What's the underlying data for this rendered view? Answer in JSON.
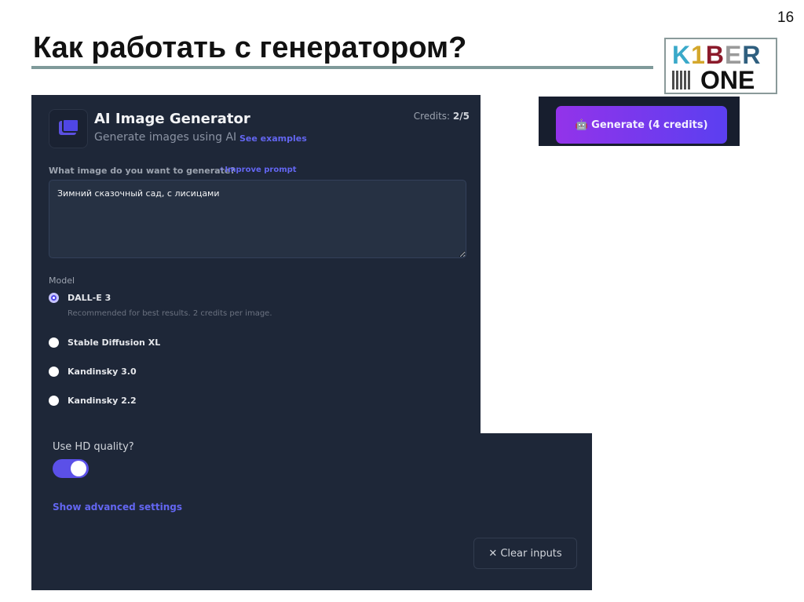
{
  "slide": {
    "number": "16",
    "title": "Как работать с генератором?",
    "logo_text": "KIBER ONE"
  },
  "app": {
    "title": "AI Image Generator",
    "subtitle": "Generate images using AI",
    "see_examples": "See examples",
    "credits_label": "Credits:",
    "credits_value": "2/5"
  },
  "prompt": {
    "label": "What image do you want to generate?",
    "improve": "✧Improve prompt",
    "value": "Зимний сказочный сад, с лисицами"
  },
  "model": {
    "label": "Model",
    "options": [
      {
        "label": "DALL-E 3",
        "selected": true,
        "desc": "Recommended for best results. 2 credits per image."
      },
      {
        "label": "Stable Diffusion XL",
        "selected": false
      },
      {
        "label": "Kandinsky 3.0",
        "selected": false
      },
      {
        "label": "Kandinsky 2.2",
        "selected": false
      }
    ]
  },
  "hd": {
    "label": "Use HD quality?",
    "on": true
  },
  "advanced": "Show advanced settings",
  "clear": "✕ Clear inputs",
  "generate": "Generate (4 credits)",
  "colors": {
    "accent": "#5b50e8",
    "panel": "#1e2738"
  }
}
